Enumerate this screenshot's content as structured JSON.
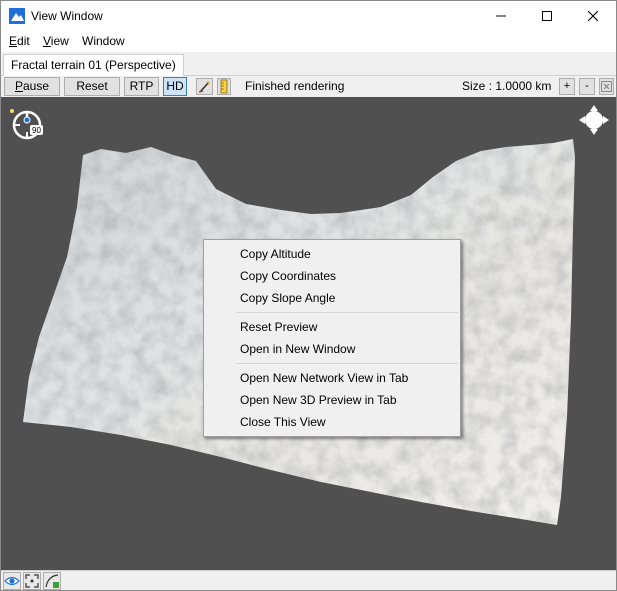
{
  "window": {
    "title": "View Window",
    "accent_color": "#1e6fd9"
  },
  "menu": {
    "items": [
      {
        "accel": "E",
        "rest": "dit"
      },
      {
        "accel": "V",
        "rest": "iew"
      },
      {
        "accel": "",
        "rest": "Window"
      }
    ]
  },
  "tabs": [
    {
      "label": "Fractal terrain 01 (Perspective)",
      "active": true
    }
  ],
  "toolbar": {
    "pause_accel": "P",
    "pause_rest": "ause",
    "reset_label": "Reset",
    "rtp_label": "RTP",
    "hd_label": "HD",
    "status": "Finished rendering",
    "size_label": "Size : 1.0000 km",
    "plus_label": "+",
    "minus_label": "-"
  },
  "viewport": {
    "compass_value": "90",
    "background_color": "#505050"
  },
  "context_menu": {
    "groups": [
      [
        "Copy Altitude",
        "Copy Coordinates",
        "Copy Slope Angle"
      ],
      [
        "Reset Preview",
        "Open in New Window"
      ],
      [
        "Open New Network View in Tab",
        "Open New 3D Preview in Tab",
        "Close This View"
      ]
    ]
  },
  "statusbar": {
    "icons": [
      "eye-icon",
      "frame-icon",
      "curve-icon"
    ]
  }
}
